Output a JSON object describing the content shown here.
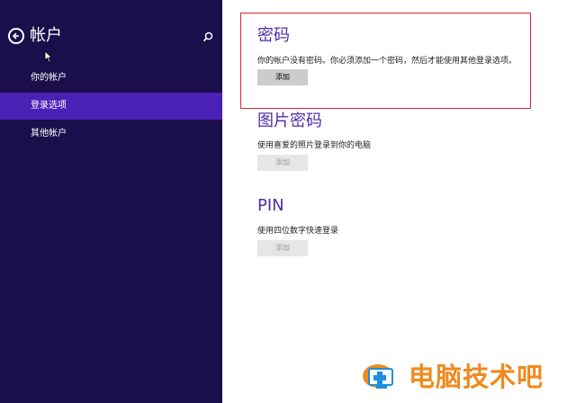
{
  "sidebar": {
    "title": "帐户",
    "items": [
      {
        "label": "你的帐户",
        "active": false
      },
      {
        "label": "登录选项",
        "active": true
      },
      {
        "label": "其他帐户",
        "active": false
      }
    ]
  },
  "sections": {
    "password": {
      "title": "密码",
      "description": "你的帐户没有密码。你必须添加一个密码，然后才能使用其他登录选项。",
      "button": "添加"
    },
    "picture_password": {
      "title": "图片密码",
      "description": "使用喜爱的照片登录到你的电脑",
      "button": "添加"
    },
    "pin": {
      "title": "PIN",
      "description": "使用四位数字快速登录",
      "button": "添加"
    }
  },
  "watermark": {
    "text": "电脑技术吧"
  },
  "colors": {
    "sidebar_bg": "#1a0e4b",
    "active_item": "#4a20b5",
    "accent": "#4c2fa8",
    "highlight": "#e0262b",
    "watermark": "#f08a1e"
  }
}
